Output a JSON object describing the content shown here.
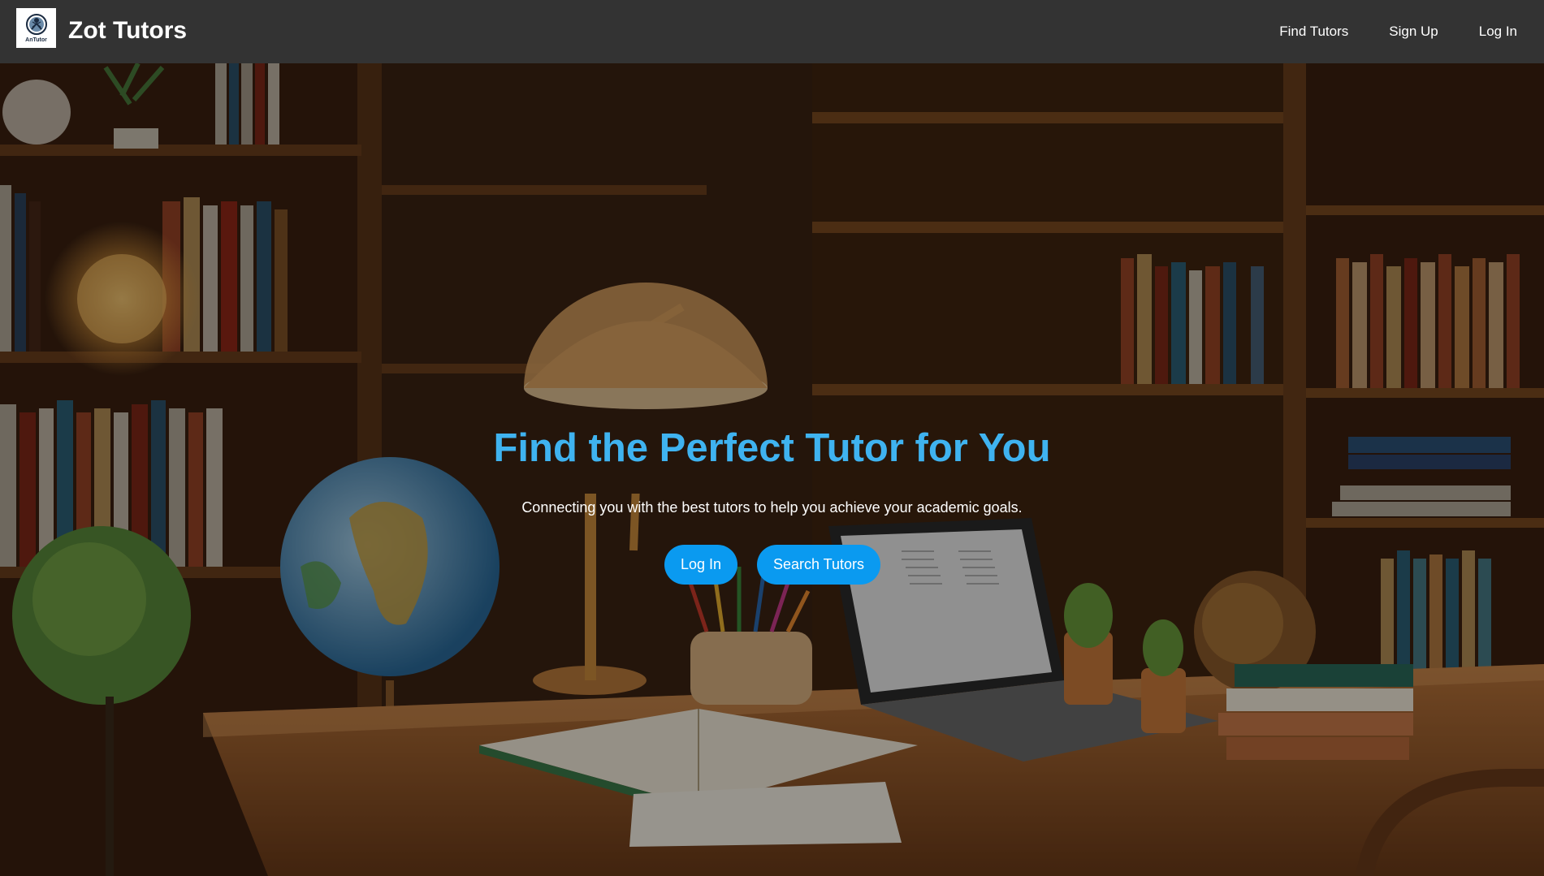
{
  "header": {
    "logo_text": "AnTutor",
    "brand": "Zot Tutors",
    "nav": [
      {
        "label": "Find Tutors"
      },
      {
        "label": "Sign Up"
      },
      {
        "label": "Log In"
      }
    ]
  },
  "hero": {
    "title": "Find the Perfect Tutor for You",
    "subtitle": "Connecting you with the best tutors to help you achieve your academic goals.",
    "login_button": "Log In",
    "search_button": "Search Tutors"
  },
  "colors": {
    "navbar": "#333333",
    "title": "#3fb3f0",
    "button": "#0a9af0"
  }
}
